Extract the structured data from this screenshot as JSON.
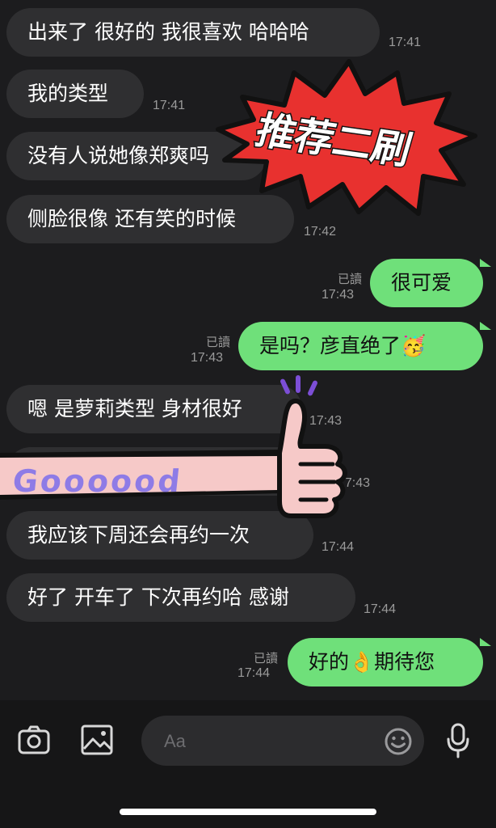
{
  "messages": [
    {
      "text": "出来了 很好的 我很喜欢 哈哈哈",
      "time": "17:41"
    },
    {
      "text": "我的类型",
      "time": "17:41"
    },
    {
      "text": "没有人说她像郑爽吗"
    },
    {
      "text": "侧脸很像 还有笑的时候",
      "time": "17:42"
    },
    {
      "text": "很可爱",
      "time": "17:43",
      "read": "已讀"
    },
    {
      "text": "是吗？彦直绝了",
      "time": "17:43",
      "read": "已讀",
      "emoji": "🥳"
    },
    {
      "text": "嗯 是萝莉类型 身材很好",
      "time": "17:43"
    },
    {
      "text": "",
      "time": "17:43"
    },
    {
      "text": "我应该下周还会再约一次",
      "time": "17:44"
    },
    {
      "text": "好了 开车了 下次再约哈 感谢",
      "time": "17:44"
    },
    {
      "text": "好的",
      "emoji": "👌",
      "text2": "期待您",
      "time": "17:44",
      "read": "已讀"
    }
  ],
  "stickers": {
    "burst_text": "推荐二刷",
    "thumb_text": "Goooood"
  },
  "composer": {
    "placeholder": "Aa"
  },
  "icons": {
    "camera": "camera-icon",
    "image": "image-icon",
    "emoji": "smiley-icon",
    "mic": "microphone-icon"
  },
  "colors": {
    "outgoing": "#6fe07a",
    "incoming": "#2f2f31",
    "burst": "#e8312f"
  }
}
